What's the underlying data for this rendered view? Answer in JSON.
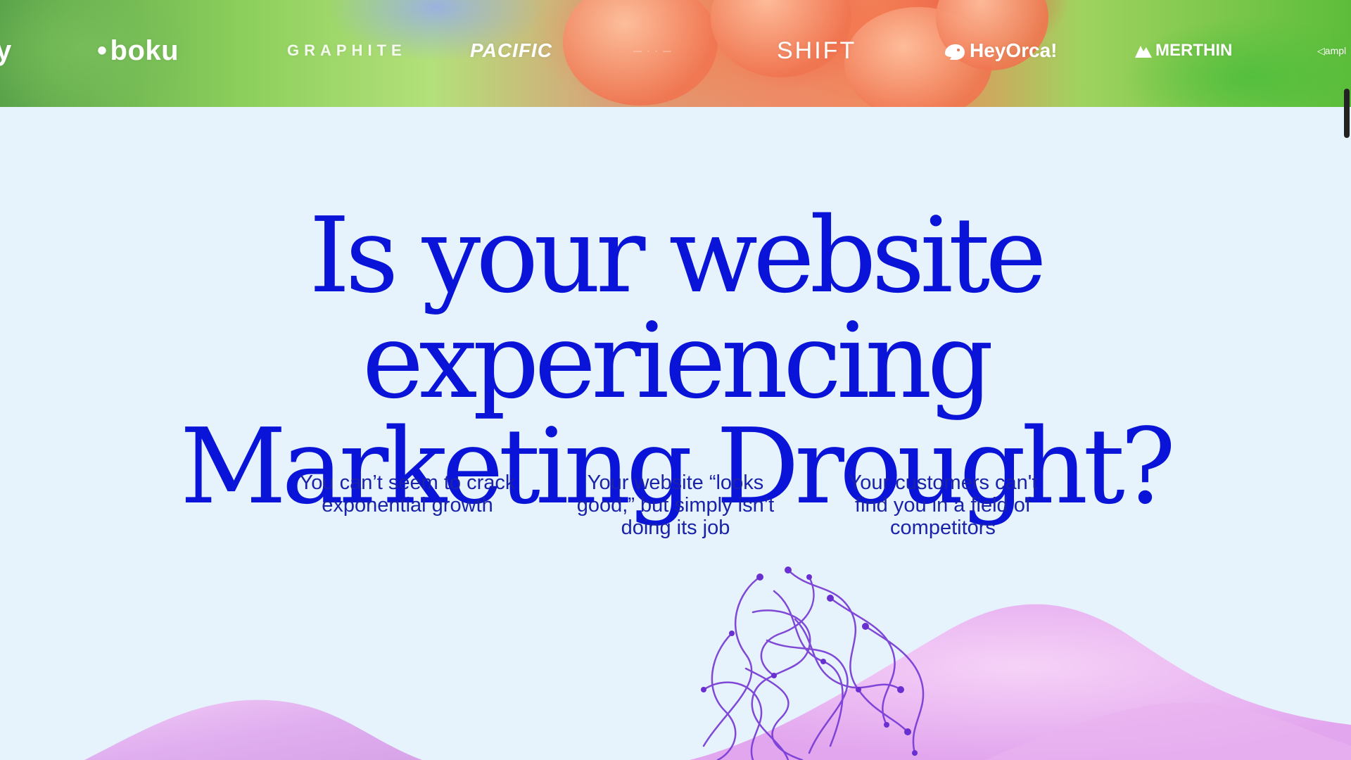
{
  "banner": {
    "logos": [
      {
        "name": "partial-logo-edge",
        "text": "y"
      },
      {
        "name": "boku",
        "text": "boku"
      },
      {
        "name": "graphite",
        "text": "GRAPHITE"
      },
      {
        "name": "pacific",
        "text": "PACIFIC"
      },
      {
        "name": "shift",
        "text": "SHIFT"
      },
      {
        "name": "heyorca",
        "text": "HeyOrca!"
      },
      {
        "name": "merthin",
        "text": "MERTHIN"
      },
      {
        "name": "amplitude",
        "text": "ampl"
      }
    ]
  },
  "hero": {
    "headline_line1": "Is your website experiencing",
    "headline_line2": "Marketing Drought?"
  },
  "pain_points": [
    {
      "text": "You can’t seem to crack exponential growth"
    },
    {
      "text": "Your website “looks good,” but simply isn’t doing its job"
    },
    {
      "text": "Your customers can't find you in a field of competitors"
    }
  ],
  "colors": {
    "background": "#e6f3fc",
    "headline": "#0a14d8",
    "body_text": "#1a22a8",
    "art_purple": "#7a3fd6",
    "art_pink": "#e8b2f0"
  }
}
